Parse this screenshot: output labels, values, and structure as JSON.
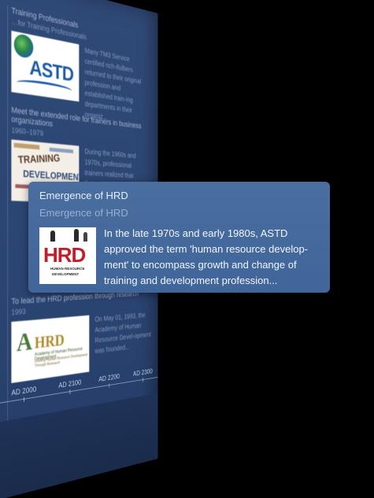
{
  "timeline": {
    "entries": [
      {
        "heading": "Training Professionals",
        "year": "…for Training Professionals",
        "excerpt": "Many TM3 Service certified nch-ifulbers returned to their original profession and established train-ing departments in their organiz...",
        "thumb_text": "ASTD",
        "thumb_icon": "globe-icon"
      },
      {
        "heading": "Meet the extended role for trainers in business organizations",
        "year": "1960–1979",
        "excerpt": "During the 1960s and 1970s, professional trainers realized that their role extended beyond the training classroom. The move toward employee involvement in many",
        "thumb_text_1": "TRAINING",
        "thumb_text_2": "DEVELOPMENT"
      },
      {
        "heading": "To lead the HRD profession through research",
        "year": "1993",
        "excerpt": "On May 01, 1993, the Academy of Human Resource Devel-opment was founded...",
        "thumb_a": "A",
        "thumb_hrd": "HRD",
        "thumb_sub1": "Academy of Human Resource Development",
        "thumb_sub2": "Leading Human Resource Development Through Research"
      }
    ],
    "axis_ticks": [
      "AD 2000",
      "AD 2100",
      "AD 2200",
      "AD 2300"
    ]
  },
  "highlight": {
    "title": "Emergence of HRD",
    "subtitle": "Emergence of HRD",
    "logo_text": "HRD",
    "logo_tag_1": "HUMAN RESOURCE",
    "logo_tag_2": "DEVELOPMENT",
    "description": "In the late 1970s and early 1980s, ASTD approved the term 'human resource develop-ment' to encompass growth and change of training and development profession...",
    "colors": {
      "card_bg": "#4a6e9e",
      "logo_red": "#c21d2a",
      "wall_bg": "#2c4674"
    }
  }
}
